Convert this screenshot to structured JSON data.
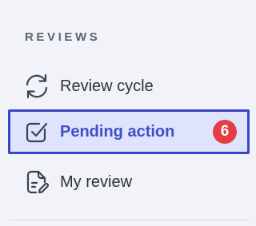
{
  "sidebar": {
    "section_title": "REVIEWS",
    "items": [
      {
        "label": "Review cycle",
        "icon": "refresh-icon",
        "active": false
      },
      {
        "label": "Pending action",
        "icon": "check-square-icon",
        "active": true,
        "badge": "6"
      },
      {
        "label": "My review",
        "icon": "document-edit-icon",
        "active": false
      }
    ]
  },
  "colors": {
    "background": "#f1f3f9",
    "accent": "#3946c8",
    "active_background": "#dfe3fb",
    "badge": "#e23c44",
    "text": "#2d3139",
    "section_title": "#5c6371"
  }
}
